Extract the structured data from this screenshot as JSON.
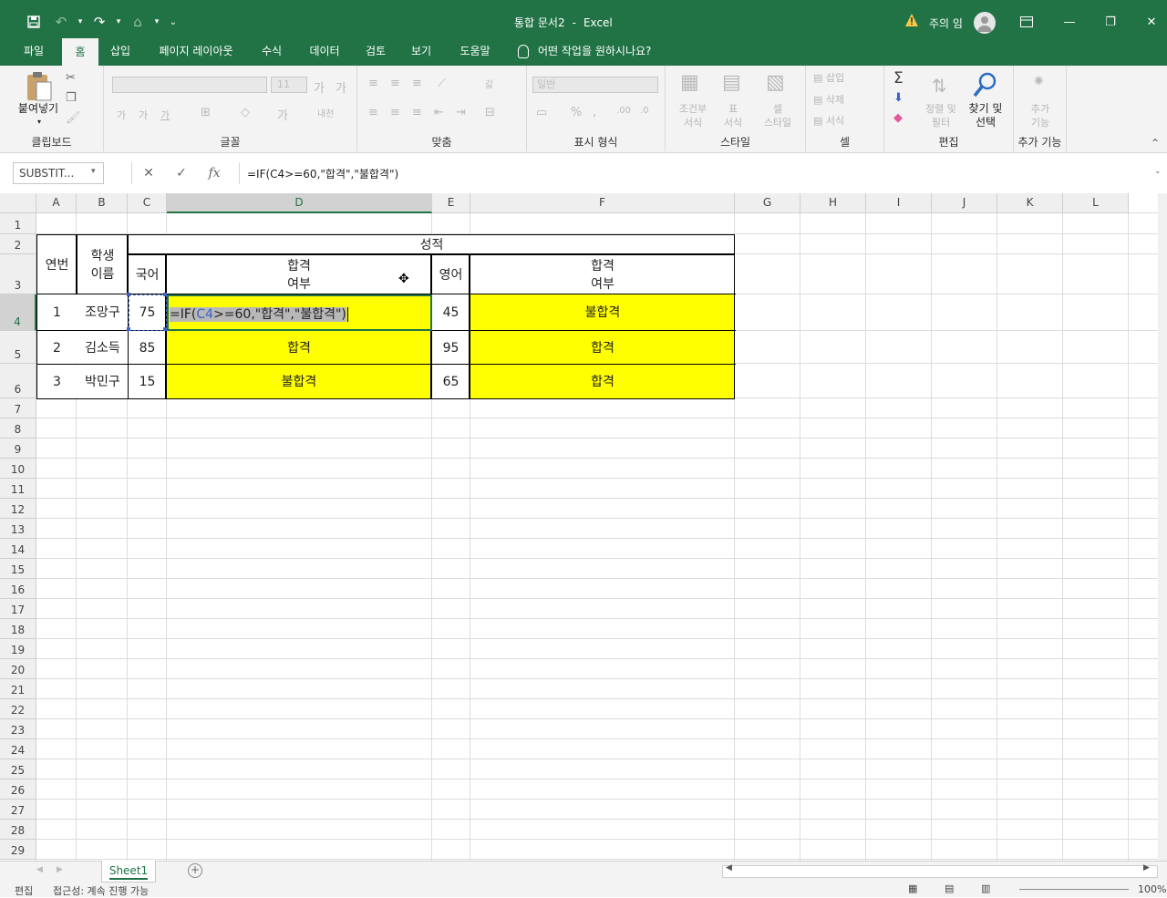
{
  "window": {
    "doc_title": "통합 문서2",
    "separator": "-",
    "app": "Excel",
    "user": "주의 임"
  },
  "qat": {
    "save_icon": "save-icon",
    "undo_icon": "undo-icon",
    "redo_icon": "redo-icon"
  },
  "tabs": [
    "파일",
    "홈",
    "삽입",
    "페이지 레이아웃",
    "수식",
    "데이터",
    "검토",
    "보기",
    "도움말"
  ],
  "tell_me": "어떤 작업을 원하시나요?",
  "ribbon": {
    "paste": "붙여넣기",
    "font_size": "11",
    "number_format": "일반",
    "conditional": "조건부",
    "conditional2": "서식",
    "table": "표",
    "table2": "서식",
    "cell_style": "셀",
    "cell_style2": "스타일",
    "insert": "삽입",
    "delete": "삭제",
    "format": "서식",
    "sort": "정렬 및",
    "sort2": "필터",
    "find": "찾기 및",
    "find2": "선택",
    "addins": "추가",
    "addins2": "기능",
    "groups": [
      "클립보드",
      "글꼴",
      "맞춤",
      "표시 형식",
      "스타일",
      "셀",
      "편집",
      "추가 기능"
    ]
  },
  "namebox": "SUBSTIT...",
  "formula_bar": {
    "cancel": "✕",
    "enter": "✓",
    "fx": "fx",
    "formula": "=IF(C4>=60,\"합격\",\"불합격\")"
  },
  "columns": [
    "A",
    "B",
    "C",
    "D",
    "E",
    "F",
    "G",
    "H",
    "I",
    "J",
    "K",
    "L"
  ],
  "rows": [
    "1",
    "2",
    "3",
    "4",
    "5",
    "6",
    "7",
    "8",
    "9",
    "10",
    "11",
    "12",
    "13",
    "14",
    "15",
    "16",
    "17",
    "18",
    "19",
    "20",
    "21",
    "22",
    "23",
    "24",
    "25",
    "26",
    "27",
    "28",
    "29"
  ],
  "table": {
    "header_grade": "성적",
    "h_no": "연번",
    "h_student1": "학생",
    "h_student2": "이름",
    "h_korean": "국어",
    "h_pass1": "합격",
    "h_pass2": "여부",
    "h_english": "영어",
    "h_pass3": "합격",
    "h_pass4": "여부",
    "rows": [
      {
        "no": "1",
        "name": "조망구",
        "kor": "75",
        "kor_result": "",
        "eng": "45",
        "eng_result": "불합격"
      },
      {
        "no": "2",
        "name": "김소득",
        "kor": "85",
        "kor_result": "합격",
        "eng": "95",
        "eng_result": "합격"
      },
      {
        "no": "3",
        "name": "박민구",
        "kor": "15",
        "kor_result": "불합격",
        "eng": "65",
        "eng_result": "합격"
      }
    ]
  },
  "editing": {
    "eq": "=IF(",
    "ref": "C4",
    "rest": ">=60,\"합격\",\"불합격\")"
  },
  "sheet_tab": "Sheet1",
  "status": {
    "mode": "편집",
    "accessibility": "접근성: 계속 진행 가능",
    "zoom": "100%"
  },
  "colors": {
    "excel_green": "#217346",
    "highlight": "#ffff00",
    "ref_blue": "#3a63c9"
  }
}
